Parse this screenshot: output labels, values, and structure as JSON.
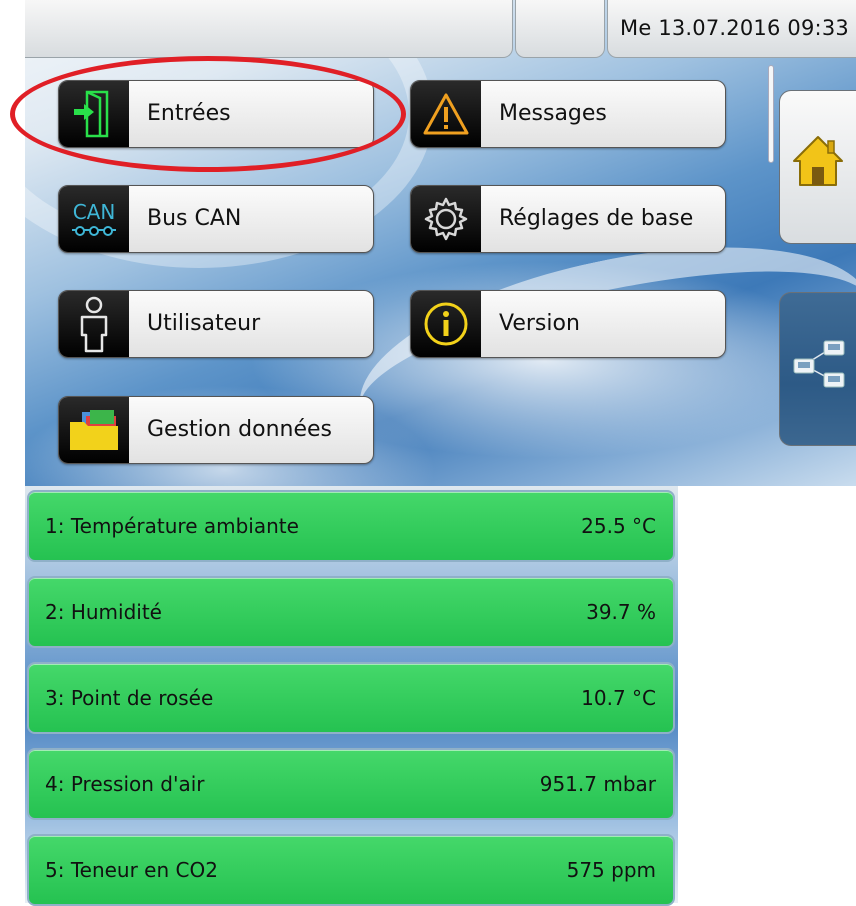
{
  "header": {
    "datetime": "Me 13.07.2016 09:33"
  },
  "menu": {
    "entrees": {
      "label": "Entrées",
      "icon": "entry-door-icon"
    },
    "messages": {
      "label": "Messages",
      "icon": "warning-icon"
    },
    "bus_can": {
      "label": "Bus CAN",
      "icon": "can-bus-icon",
      "icon_text": "CAN"
    },
    "reglages": {
      "label": "Réglages de base",
      "icon": "gear-icon"
    },
    "utilisateur": {
      "label": "Utilisateur",
      "icon": "user-icon"
    },
    "version": {
      "label": "Version",
      "icon": "info-icon"
    },
    "gestion": {
      "label": "Gestion données",
      "icon": "folder-icon"
    }
  },
  "side": {
    "home_icon": "home-icon",
    "network_icon": "network-devices-icon"
  },
  "sensors": [
    {
      "name": "1: Température ambiante",
      "value": "25.5 °C"
    },
    {
      "name": "2: Humidité",
      "value": "39.7 %"
    },
    {
      "name": "3: Point de rosée",
      "value": "10.7 °C"
    },
    {
      "name": "4: Pression d'air",
      "value": "951.7 mbar"
    },
    {
      "name": "5: Teneur en CO2",
      "value": "575 ppm"
    }
  ],
  "colors": {
    "sensor_green": "#2fcb5a",
    "highlight_red": "#e01f26",
    "accent_blue": "#3d79b8"
  }
}
